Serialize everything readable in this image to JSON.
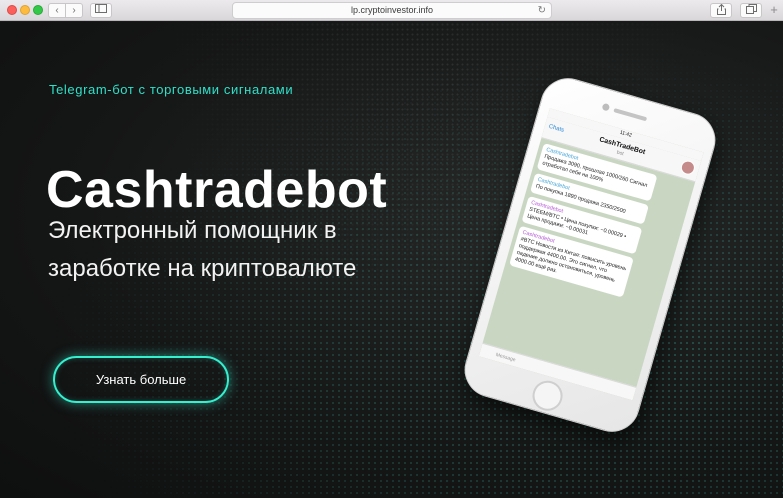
{
  "browser": {
    "url": "lp.cryptoinvestor.info",
    "back_glyph": "‹",
    "forward_glyph": "›",
    "reload_glyph": "↻",
    "plus_glyph": "+"
  },
  "hero": {
    "tagline": "Telegram-бот с торговыми сигналами",
    "brand": "Cashtradebot",
    "subtitle_line1": "Электронный помощник в",
    "subtitle_line2": "заработке на криптовалюте",
    "cta_label": "Узнать больше"
  },
  "phone": {
    "status_time": "11:42",
    "chat_title": "CashTradeBot",
    "chat_subtitle": "bot",
    "back_label": "Chats",
    "messages": [
      {
        "from": "Cashtradebot",
        "text": "Продажа 3090, прошлая 1000/260 Сигнал отработал себя на 100%"
      },
      {
        "from": "Cashtradebot",
        "text": "По покупка 1890 продажа 2350/2500"
      },
      {
        "from": "Cashtradebot",
        "text": "STEEM/BTC • Цена покупки: ~0.00029 • Цена продажи: ~0.00031"
      },
      {
        "from": "Cashtradebot",
        "text": "#BTC Новости из Китая: повысить уровень поддержки 4400.00. Это сигнал, что падение должно остановиться, уровень 4000.00 ещё раз."
      }
    ],
    "input_placeholder": "Message"
  },
  "colors": {
    "accent": "#2ee0c8",
    "button_border": "#34f0cf",
    "background": "#151616"
  }
}
